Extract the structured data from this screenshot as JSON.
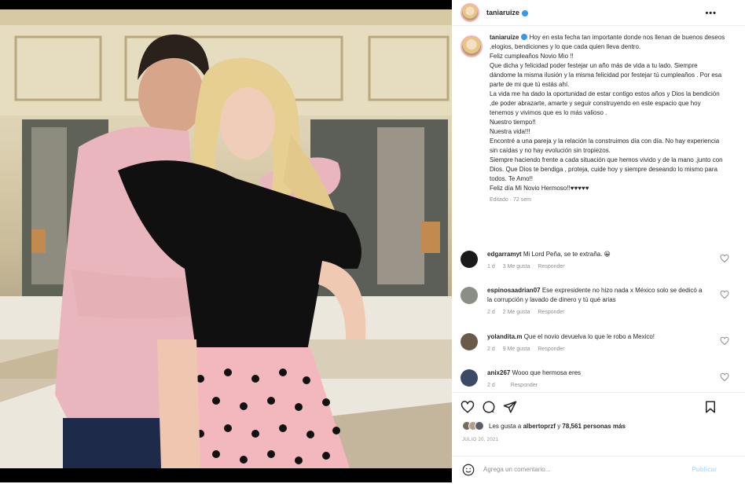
{
  "post": {
    "username": "taniaruize",
    "more_icon": "more-horizontal-icon"
  },
  "caption": {
    "username": "taniaruize",
    "lines": [
      "Hoy en esta fecha tan importante donde nos llenan de buenos deseos ,elogios, bendiciones y lo que cada quien lleva dentro.",
      "Feliz cumpleaños Novio Mio !!",
      "Que dicha y felicidad poder festejar un año más de vida a tu lado. Siempre dándome la misma ilusión y la misma felicidad por festejar tú cumpleaños . Por esa parte de mi que tú estás ahí.",
      "La vida me ha dado la oportunidad de estar contigo estos años y Dios la bendición ,de poder abrazarte, amarte y seguir construyendo en este espacio que hoy tenemos y vivimos que es lo más valioso .",
      "Nuestro tiempo!!",
      "Nuestra vida!!!",
      "Encontré a una pareja y la relación la construimos día con día. No hay experiencia sin caídas y no hay evolución sin tropiezos.",
      "Siempre haciendo frente a cada situación que hemos vivido y de la mano ,junto con Dios. Que Dios te bendiga , proteja, cuide hoy y siempre deseando lo mismo para todos. Te Amo!!",
      "Feliz día Mi Novio Hermoso!!♥♥♥♥♥"
    ],
    "meta": "Editado · 72 sem"
  },
  "comments": [
    {
      "user": "edgarramyt",
      "text": "Mi Lord Peña, se te extraña. 😀",
      "age": "1 d",
      "likes": "3 Me gusta",
      "reply": "Responder",
      "avatar_color": "#1a1a1a"
    },
    {
      "user": "espinosaadrian07",
      "text": "Ese expresidente no hizo nada x México solo se dedicó a la corrupción y lavado de dinero y tú qué arias",
      "age": "2 d",
      "likes": "2 Me gusta",
      "reply": "Responder",
      "avatar_color": "#8a8f86"
    },
    {
      "user": "yolandita.m",
      "text": "Que el novio devuelva lo que le robo a Mexico!",
      "age": "2 d",
      "likes": "9 Me gusta",
      "reply": "Responder",
      "avatar_color": "#6b5a4a"
    },
    {
      "user": "anix267",
      "text": "Wooo que hermosa eres",
      "age": "2 d",
      "likes": "",
      "reply": "Responder",
      "avatar_color": "#3a4a66"
    }
  ],
  "actions": {
    "like_icon": "heart-icon",
    "comment_icon": "comment-icon",
    "share_icon": "send-icon",
    "save_icon": "bookmark-icon"
  },
  "likes": {
    "prefix": "Les gusta a",
    "user": "albertoprzf",
    "middle": "y",
    "count": "78,561 personas más"
  },
  "date": "JULIO 20, 2021",
  "composer": {
    "placeholder": "Agrega un comentario...",
    "publish": "Publicar",
    "emoji_icon": "smile-icon"
  },
  "colors": {
    "link": "#b2dffc",
    "verified": "#3897f0",
    "meta": "#8e8e8e"
  }
}
